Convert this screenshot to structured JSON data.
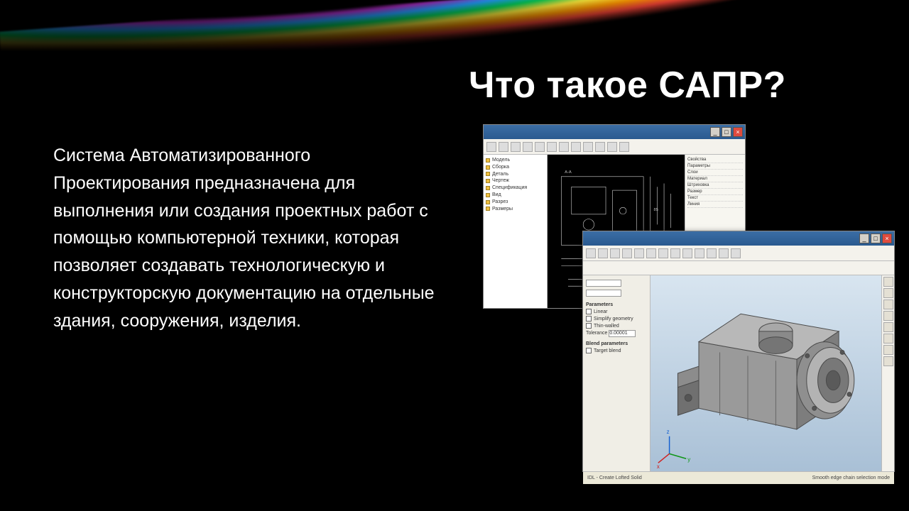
{
  "title": "Что такое САПР?",
  "body": "Система Автоматизированного Проектирования предназначена для выполнения или создания проектных работ с помощью компьютерной техники, которая позволяет создавать технологическую и конструкторскую документацию на отдельные здания, сооружения, изделия.",
  "cad2d": {
    "tree_items": [
      "Модель",
      "Сборка",
      "Деталь",
      "Чертеж",
      "Спецификация",
      "Вид",
      "Разрез",
      "Размеры"
    ],
    "panel_items": [
      "Свойства",
      "Параметры",
      "Слои",
      "Материал",
      "Штриховка",
      "Размер",
      "Текст",
      "Линия"
    ]
  },
  "cad3d": {
    "props": {
      "section_params": "Parameters",
      "chk_linear": "Linear",
      "chk_simplify": "Simplify geometry",
      "chk_thinwalled": "Thin-walled",
      "tolerance_label": "Tolerance",
      "tolerance_value": "0.00001",
      "section_blend": "Blend parameters",
      "chk_target": "Target blend"
    },
    "status_left": "IDL - Create Lofted Solid",
    "status_right": "Smooth edge chain selection mode"
  }
}
